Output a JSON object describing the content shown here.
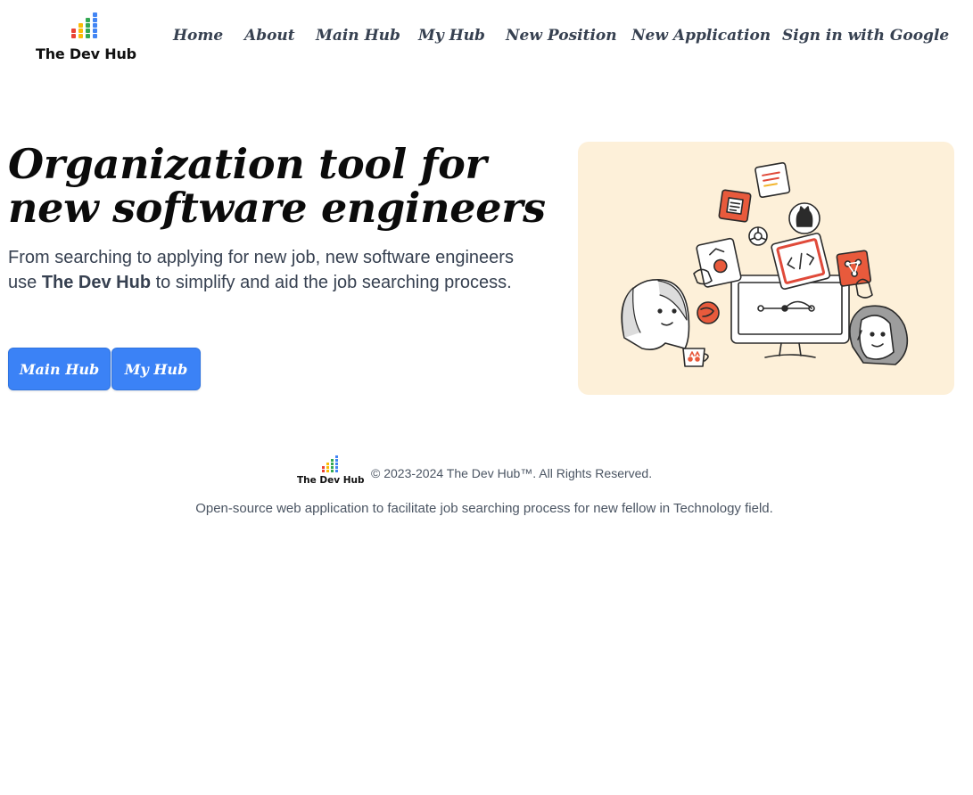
{
  "header": {
    "logo_text": "The Dev Hub",
    "nav": [
      {
        "label": "Home"
      },
      {
        "label": "About"
      },
      {
        "label": "Main Hub"
      },
      {
        "label": "My Hub"
      },
      {
        "label": "New Position"
      },
      {
        "label": "New Application"
      },
      {
        "label": "Sign in with Google"
      }
    ]
  },
  "hero": {
    "title": "Organization tool for new software engineers",
    "desc_before": "From searching to applying for new job, new software engineers use ",
    "desc_brand": "The Dev Hub",
    "desc_after": " to simplify and aid the job searching process.",
    "buttons": {
      "main_hub": "Main Hub",
      "my_hub": "My Hub"
    }
  },
  "footer": {
    "logo_text": "The Dev Hub",
    "copyright": "© 2023-2024 The Dev Hub™. All Rights Reserved.",
    "tagline": "Open-source web application to facilitate job searching process for new fellow in Technology field."
  },
  "colors": {
    "accent": "#3b82f6",
    "illustration_bg": "#fdf0d9",
    "logo_green": "#34a853",
    "logo_yellow": "#fbbc05",
    "logo_red": "#ea4335",
    "logo_blue": "#4285f4"
  }
}
